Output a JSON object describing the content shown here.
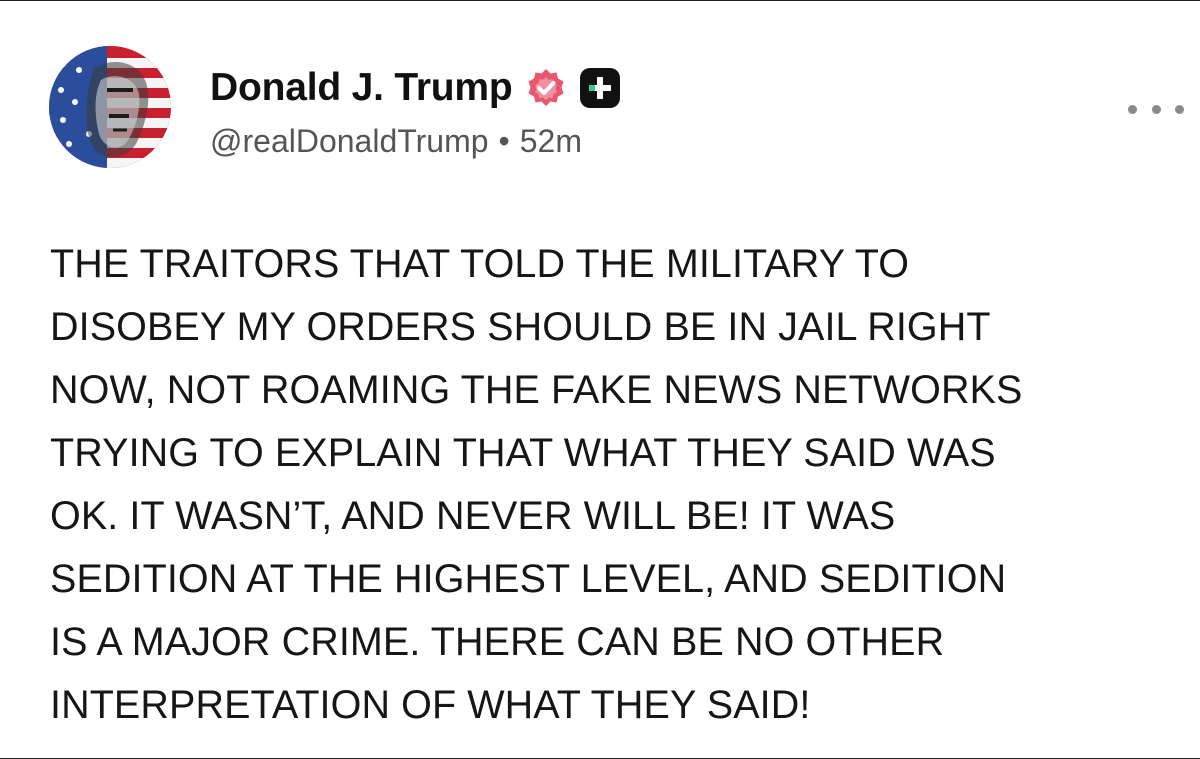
{
  "post": {
    "display_name": "Donald J. Trump",
    "handle": "@realDonaldTrump",
    "separator": "•",
    "time": "52m",
    "body_lines": [
      "THE TRAITORS THAT TOLD THE MILITARY TO",
      "DISOBEY MY ORDERS SHOULD BE IN JAIL RIGHT",
      "NOW, NOT ROAMING THE FAKE NEWS NETWORKS",
      "TRYING TO EXPLAIN THAT WHAT THEY SAID WAS",
      "OK. IT WASN’T, AND NEVER WILL BE! IT WAS",
      "SEDITION AT THE HIGHEST LEVEL, AND SEDITION",
      "IS A MAJOR CRIME. THERE CAN BE NO OTHER",
      "INTERPRETATION OF WHAT THEY SAID!"
    ]
  },
  "icons": {
    "avatar": "flag-portrait-avatar",
    "verified": "verified-badge-icon",
    "plus": "plus-badge-icon",
    "more": "more-options-icon"
  },
  "colors": {
    "verified_badge": "#e8576f",
    "plus_badge_bg": "#111111",
    "plus_badge_accent": "#2fd38a",
    "text": "#161616",
    "meta_text": "#555555",
    "more_dots": "#8a8a8a"
  }
}
